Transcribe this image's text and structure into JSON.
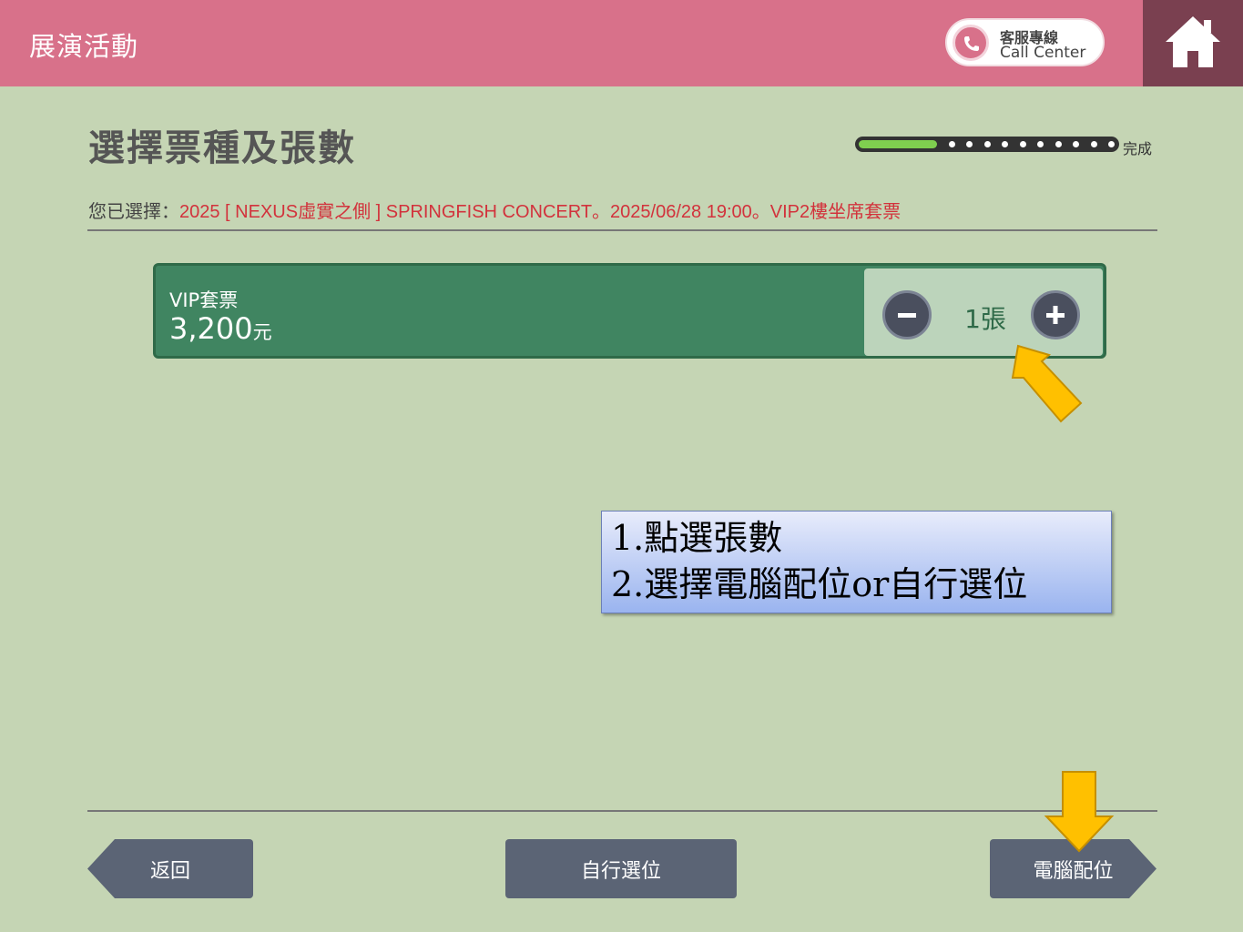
{
  "header": {
    "title": "展演活動",
    "call_center": {
      "label_zh": "客服專線",
      "label_en": "Call Center",
      "icon": "phone-icon"
    },
    "home_icon": "home-icon"
  },
  "page": {
    "title": "選擇票種及張數",
    "progress": {
      "label": "完成",
      "fraction": 0.3
    },
    "selection_prefix": "您已選擇：",
    "selection_detail": "2025 [ NEXUS虛實之側 ] SPRINGFISH CONCERT。2025/06/28 19:00。VIP2樓坐席套票"
  },
  "ticket": {
    "name": "VIP套票",
    "price": "3,200",
    "price_unit": "元",
    "quantity": "1張"
  },
  "annotation": {
    "line1": "1.點選張數",
    "line2": "2.選擇電腦配位or自行選位"
  },
  "footer": {
    "back": "返回",
    "self_select": "自行選位",
    "auto_assign": "電腦配位"
  },
  "colors": {
    "header": "#d8718a",
    "home": "#7a4050",
    "background": "#c5d5b4",
    "ticket": "#408561",
    "accent_red": "#d2323c",
    "button": "#5b6475",
    "pointer_arrow": "#ffc000"
  }
}
